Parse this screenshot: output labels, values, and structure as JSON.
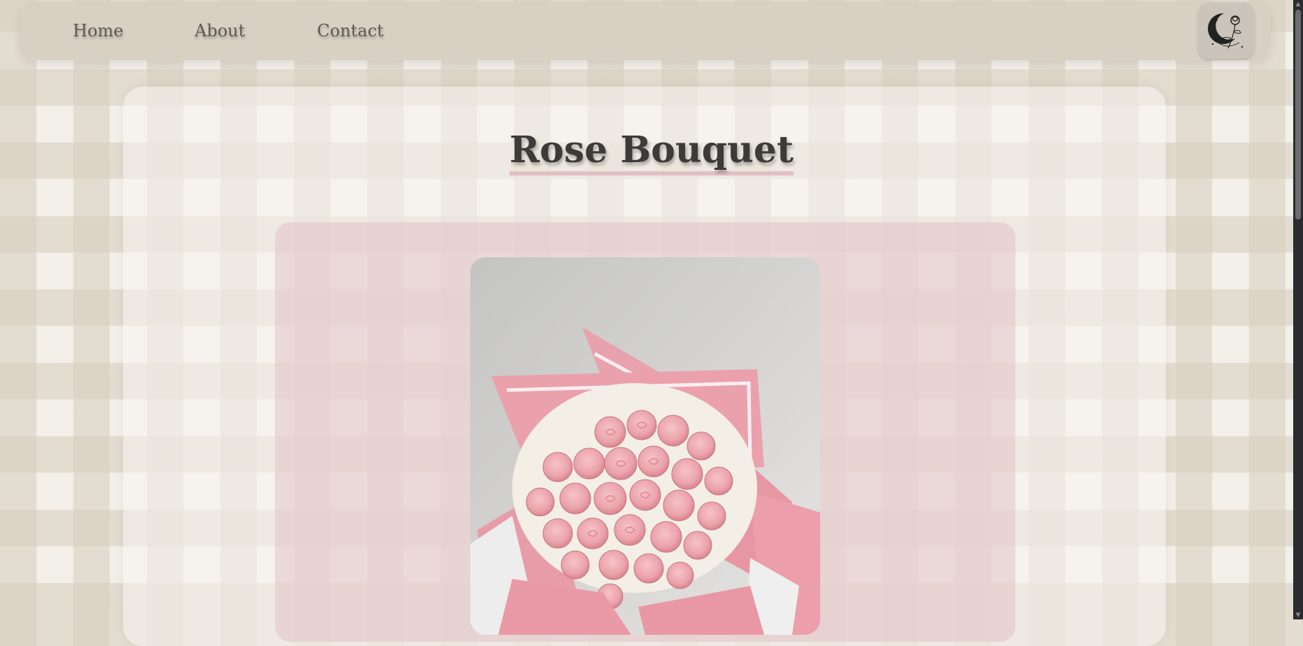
{
  "nav": {
    "items": [
      {
        "label": "Home"
      },
      {
        "label": "About"
      },
      {
        "label": "Contact"
      }
    ],
    "logo_icon": "moon-rose-logo-icon"
  },
  "product": {
    "title": "Rose Bouquet",
    "image_icon": "rose-bouquet-photo"
  },
  "colors": {
    "nav_bg": "#d8d0c3",
    "card_pink": "#e1c3c7",
    "title_text": "#3d3b39",
    "underline": "#ddb2ba"
  }
}
